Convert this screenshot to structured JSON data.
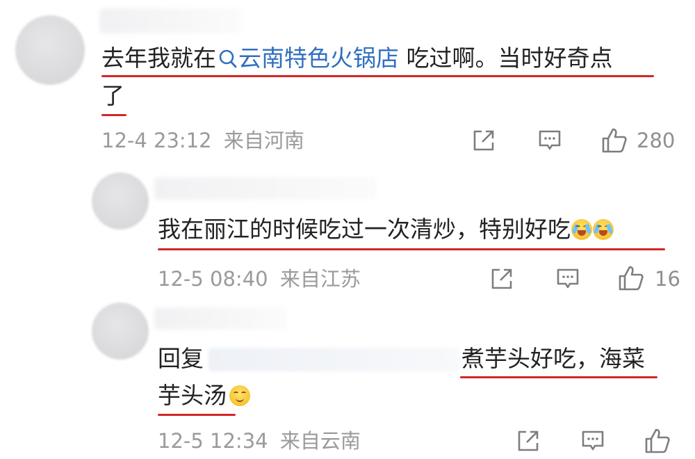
{
  "comments": [
    {
      "text_before": "去年我就在",
      "link_text": "云南特色火锅店",
      "text_after": " 吃过啊。当时好奇点",
      "text_line2": "了",
      "time": "12-4 23:12",
      "location": "来自河南",
      "likes": "280"
    },
    {
      "text": "我在丽江的时候吃过一次清炒，特别好吃",
      "time": "12-5 08:40",
      "location": "来自江苏",
      "likes": "16"
    },
    {
      "reply_prefix": "回复",
      "text_line1": "煮芋头好吃，海菜",
      "text_line2": "芋头汤",
      "time": "12-5 12:34",
      "location": "来自云南",
      "likes": ""
    }
  ],
  "icons": {
    "search": "search-icon",
    "share": "share-icon",
    "comment": "comment-icon",
    "like": "thumbs-up-icon",
    "emoji_cry": "crying-laugh-emoji-icon",
    "emoji_smirk": "smirk-emoji-icon"
  },
  "colors": {
    "link": "#2f6fc0",
    "underline": "#d42626",
    "meta": "#9a9a9a"
  }
}
